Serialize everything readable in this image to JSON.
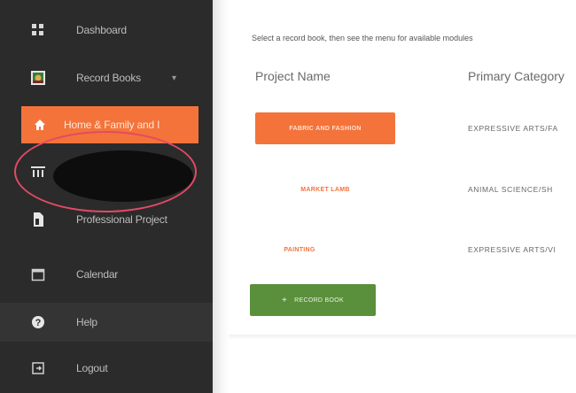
{
  "sidebar": {
    "items": [
      {
        "label": "Dashboard",
        "icon": "dashboard-grid-icon"
      },
      {
        "label": "Record Books",
        "icon": "record-book-icon"
      },
      {
        "label": "Home & Family and I",
        "icon": "home-icon"
      },
      {
        "label": "",
        "icon": "columns-icon"
      },
      {
        "label": "Professional Project",
        "icon": "document-icon"
      },
      {
        "label": "Calendar",
        "icon": "calendar-icon"
      },
      {
        "label": "Help",
        "icon": "help-icon"
      },
      {
        "label": "Logout",
        "icon": "logout-icon"
      }
    ],
    "caret": "▾"
  },
  "main": {
    "instruction": "Select a record book, then see the menu for available modules",
    "columns": {
      "project_name": "Project Name",
      "primary_category": "Primary Category"
    },
    "rows": [
      {
        "project": "FABRIC AND FASHION",
        "category": "EXPRESSIVE ARTS/FA"
      },
      {
        "project": "MARKET LAMB",
        "category": "ANIMAL SCIENCE/SH"
      },
      {
        "project": "PAINTING",
        "category": "EXPRESSIVE ARTS/VI"
      }
    ],
    "add_button": {
      "plus": "+",
      "label": "RECORD BOOK"
    }
  },
  "colors": {
    "sidebar_bg": "#2b2b2b",
    "accent_orange": "#f4733a",
    "add_green": "#5a8f3c",
    "annotation_red": "#e24a64"
  }
}
